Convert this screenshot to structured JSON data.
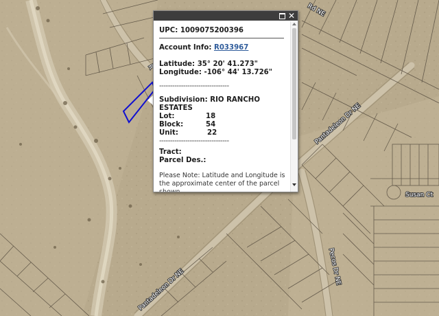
{
  "map": {
    "road_labels": [
      {
        "id": "pantadeleon-upper",
        "text": "Pantadeleon Dr NE"
      },
      {
        "id": "pantadeleon-lower",
        "text": "Pantadeleon Dr NE"
      },
      {
        "id": "susan",
        "text": "Susan Ct"
      },
      {
        "id": "pecos",
        "text": "Pecos Dr NE"
      },
      {
        "id": "top-road",
        "text": "Rd NE"
      },
      {
        "id": "left-road",
        "text": "R"
      }
    ],
    "parcel_highlight_color": "#1010d0"
  },
  "popup": {
    "upc_label": "UPC:",
    "upc_value": "1009075200396",
    "account_label": "Account Info:",
    "account_value": "R033967",
    "latitude_label": "Latitude:",
    "latitude_value": "35° 20' 41.273\"",
    "longitude_label": "Longitude:",
    "longitude_value": "-106° 44' 13.726\"",
    "dash_line": "--------------------------------",
    "subdivision_label": "Subdivision:",
    "subdivision_value": "RIO RANCHO",
    "subdivision_value_2": "ESTATES",
    "lot_label": "Lot:",
    "lot_value": "18",
    "block_label": "Block:",
    "block_value": "54",
    "unit_label": "Unit:",
    "unit_value": "22",
    "tract_label": "Tract:",
    "parcel_des_label": "Parcel Des.:",
    "note": "Please Note: Latitude and Longitude is the approximate center of the parcel shown.",
    "maximize_icon": "window-maximize-icon",
    "close_icon": "close-icon",
    "close_glyph": "✕"
  }
}
